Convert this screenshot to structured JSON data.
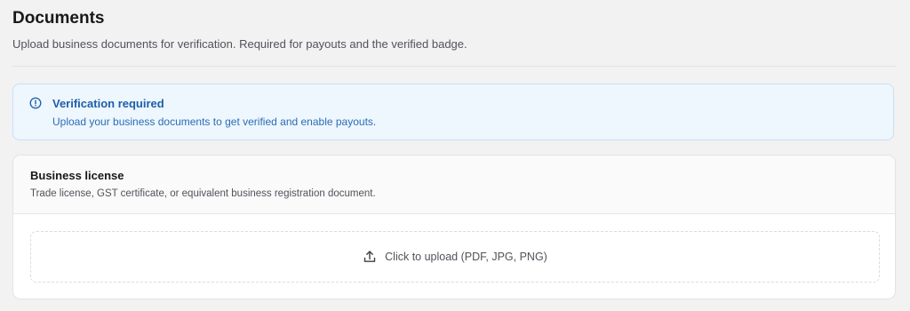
{
  "page": {
    "title": "Documents",
    "subtitle": "Upload business documents for verification. Required for payouts and the verified badge."
  },
  "alert": {
    "icon": "info-circle-icon",
    "title": "Verification required",
    "text": "Upload your business documents to get verified and enable payouts.",
    "color": "#1d5fa8",
    "background": "#eef6fe"
  },
  "document_card": {
    "title": "Business license",
    "description": "Trade license, GST certificate, or equivalent business registration document.",
    "upload": {
      "icon": "upload-icon",
      "label": "Click to upload (PDF, JPG, PNG)"
    }
  }
}
